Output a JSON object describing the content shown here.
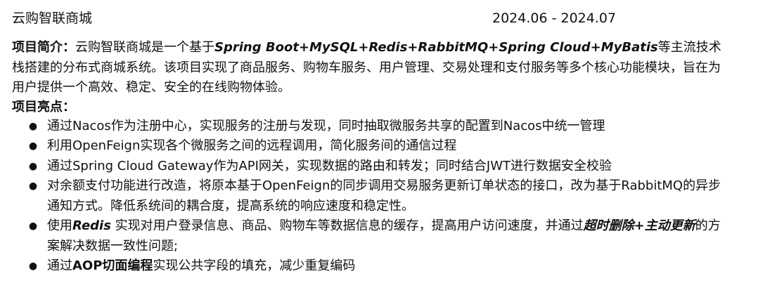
{
  "header": {
    "project_name": "云购智联商城",
    "dates": "2024.06 - 2024.07"
  },
  "summary": {
    "label": "项目简介：",
    "text_before": "云购智联商城是一个基于",
    "tech_stack": "Spring Boot+MySQL+Redis+RabbitMQ+Spring Cloud+MyBatis",
    "text_after": "等主流技术栈搭建的分布式商城系统。该项目实现了商品服务、购物车服务、用户管理、交易处理和支付服务等多个核心功能模块，旨在为用户提供一个高效、稳定、安全的在线购物体验。"
  },
  "highlights": {
    "title": "项目亮点：",
    "bullet_symbol": "●",
    "items": [
      {
        "text": "通过Nacos作为注册中心，实现服务的注册与发现，同时抽取微服务共享的配置到Nacos中统一管理"
      },
      {
        "text": "利用OpenFeign实现各个微服务之间的远程调用，简化服务间的通信过程"
      },
      {
        "text": "通过Spring Cloud Gateway作为API网关，实现数据的路由和转发；同时结合JWT进行数据安全校验"
      },
      {
        "text": "对余额支付功能进行改造，将原本基于OpenFeign的同步调用交易服务更新订单状态的接口，改为基于RabbitMQ的异步通知方式。降低系统间的耦合度，提高系统的响应速度和稳定性。"
      },
      {
        "prefix": "使用",
        "em1": "Redis",
        "middle": " 实现对用户登录信息、商品、购物车等数据信息的缓存，提高用户访问速度，并通过",
        "em2": "超时删除+主动更新",
        "suffix": "的方案解决数据一致性问题;"
      },
      {
        "prefix": "通过",
        "strong": "AOP切面编程",
        "suffix": "实现公共字段的填充，减少重复编码"
      }
    ]
  }
}
